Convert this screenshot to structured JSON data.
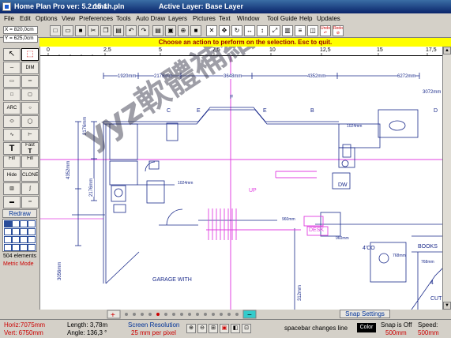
{
  "title": {
    "app": "Home Plan Pro ver: 5.2.15.1",
    "file": "ranch.pln",
    "layer": "Active Layer: Base Layer"
  },
  "menu": [
    "File",
    "Edit",
    "Options",
    "View",
    "Preferences",
    "Tools",
    "Auto Draw",
    "Layers",
    "Pictures",
    "Text",
    "Window",
    "Tool Guide",
    "Help",
    "Updates"
  ],
  "coords": {
    "x": "X = 820,0cm",
    "y": "Y = 625,0cm"
  },
  "toolbar": {
    "undo": "Undo",
    "redo": "Redo"
  },
  "prompt": "Choose an action to perform on the selection. Esc to quit.",
  "ruler": [
    "0",
    "2,5",
    "5",
    "7,5",
    "10",
    "12,5",
    "15",
    "17,5"
  ],
  "dimensions": [
    "1920mm",
    "2176mm",
    "3648mm",
    "4352mm",
    "6272mm",
    "3072mm",
    "2176mm",
    "4352mm",
    "2176mm",
    "960mm",
    "960mm",
    "1024mm",
    "1024mm",
    "768mm",
    "768mm",
    "312mm",
    "2176mm",
    "3056mm",
    "500mm"
  ],
  "labels": {
    "c": "C",
    "e1": "E",
    "f": "F",
    "e2": "E",
    "b": "B",
    "d": "D",
    "up": "UP",
    "desk": "DESK",
    "dw": "DW",
    "books": "BOOKS",
    "garage": "GARAGE WITH",
    "fourco": "4'CO",
    "fourp": "4",
    "cut": "CUT"
  },
  "lefttools": {
    "dim": "DIM",
    "fast": "Fast",
    "fill": "Fill",
    "fill2": "Fill",
    "clone": "CLONE",
    "hide": "Hide",
    "text": "T",
    "arc": "ARC"
  },
  "redraw": "Redraw",
  "elements": "504 elements",
  "metric": "Metric Mode",
  "snap_settings": "Snap Settings",
  "status": {
    "horiz": "Horiz:7075mm",
    "vert": "Vert: 6750mm",
    "length": "Length: 3,78m",
    "angle": "Angle: 136,3 °",
    "screen_res": "Screen Resolution",
    "per_pixel": "25 mm per pixel",
    "spacebar": "spacebar changes line",
    "color": "Color",
    "snap_off": "Snap is Off",
    "snap_val": "500mm",
    "speed": "Speed:",
    "speed_val": "500mm"
  },
  "watermark": "yyz軟體補給站 http://31.to"
}
